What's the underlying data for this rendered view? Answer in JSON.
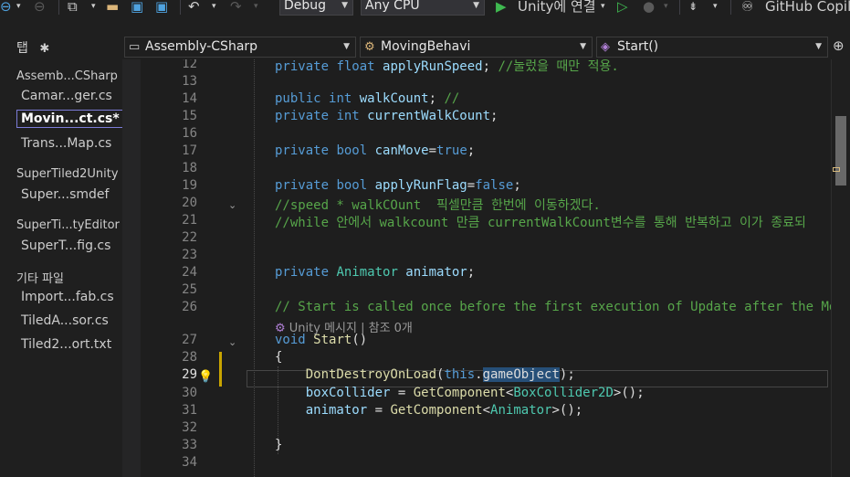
{
  "toolbar": {
    "configuration": "Debug",
    "platform": "Any CPU",
    "run_target": "Unity에 연결",
    "copilot": "GitHub Copilo"
  },
  "navbar": {
    "tab_label": "탭",
    "project_combo": "Assembly-CSharp",
    "class_combo": "MovingBehavi",
    "member_combo": "Start()"
  },
  "sidebar": {
    "items": [
      {
        "kind": "group",
        "label": "Assemb...CSharp"
      },
      {
        "kind": "file",
        "label": "Camar...ger.cs"
      },
      {
        "kind": "file",
        "label": "Movin...ct.cs*",
        "active": true
      },
      {
        "kind": "file",
        "label": "Trans...Map.cs"
      },
      {
        "kind": "group",
        "label": "SuperTiled2Unity"
      },
      {
        "kind": "file",
        "label": "Super...smdef"
      },
      {
        "kind": "group",
        "label": "SuperTi...tyEditor"
      },
      {
        "kind": "file",
        "label": "SuperT...fig.cs"
      },
      {
        "kind": "group",
        "label": "기타 파일"
      },
      {
        "kind": "file",
        "label": "Import...fab.cs"
      },
      {
        "kind": "file",
        "label": "TiledA...sor.cs"
      },
      {
        "kind": "file",
        "label": "Tiled2...ort.txt"
      }
    ]
  },
  "editor": {
    "line_numbers": [
      "12",
      "13",
      "14",
      "15",
      "16",
      "17",
      "18",
      "19",
      "20",
      "21",
      "22",
      "23",
      "24",
      "25",
      "26",
      "27",
      "28",
      "29",
      "30",
      "31",
      "32",
      "33",
      "34"
    ],
    "codelens": "Unity 메시지 | 참조 0개",
    "lines": [
      {
        "n": "12",
        "tokens": [
          [
            "kw",
            "private "
          ],
          [
            "kw",
            "float "
          ],
          [
            "var",
            "applyRunSpeed"
          ],
          [
            "",
            "; "
          ],
          [
            "cm",
            "//눌렀을 때만 적용."
          ]
        ]
      },
      {
        "n": "13",
        "tokens": []
      },
      {
        "n": "14",
        "tokens": [
          [
            "kw",
            "public "
          ],
          [
            "kw",
            "int "
          ],
          [
            "var",
            "walkCount"
          ],
          [
            "",
            "; "
          ],
          [
            "cm",
            "//"
          ]
        ]
      },
      {
        "n": "15",
        "tokens": [
          [
            "kw",
            "private "
          ],
          [
            "kw",
            "int "
          ],
          [
            "var",
            "currentWalkCount"
          ],
          [
            "",
            ";"
          ]
        ]
      },
      {
        "n": "16",
        "tokens": []
      },
      {
        "n": "17",
        "tokens": [
          [
            "kw",
            "private "
          ],
          [
            "kw",
            "bool "
          ],
          [
            "var",
            "canMove"
          ],
          [
            "",
            "="
          ],
          [
            "kw",
            "true"
          ],
          [
            "",
            ";"
          ]
        ]
      },
      {
        "n": "18",
        "tokens": []
      },
      {
        "n": "19",
        "tokens": [
          [
            "kw",
            "private "
          ],
          [
            "kw",
            "bool "
          ],
          [
            "var",
            "applyRunFlag"
          ],
          [
            "",
            "="
          ],
          [
            "kw",
            "false"
          ],
          [
            "",
            ";"
          ]
        ]
      },
      {
        "n": "20",
        "tokens": [
          [
            "cm",
            "//speed * walkCOunt  픽셀만큼 한번에 이동하겠다."
          ]
        ]
      },
      {
        "n": "21",
        "tokens": [
          [
            "cm",
            "//while 안에서 walkcount 만큼 currentWalkCount변수를 통해 반복하고 이가 종료되"
          ]
        ]
      },
      {
        "n": "22",
        "tokens": []
      },
      {
        "n": "23",
        "tokens": []
      },
      {
        "n": "24",
        "tokens": [
          [
            "kw",
            "private "
          ],
          [
            "ty",
            "Animator "
          ],
          [
            "var",
            "animator"
          ],
          [
            "",
            ";"
          ]
        ]
      },
      {
        "n": "25",
        "tokens": []
      },
      {
        "n": "26",
        "tokens": [
          [
            "cm",
            "// Start is called once before the first execution of Update after the MonoBeh"
          ]
        ]
      },
      {
        "n": "27",
        "tokens": [
          [
            "kw",
            "void "
          ],
          [
            "meth",
            "Start"
          ],
          [
            "",
            "()"
          ]
        ]
      },
      {
        "n": "28",
        "tokens": [
          [
            "",
            "{"
          ]
        ]
      },
      {
        "n": "29",
        "tokens": [
          [
            "",
            "    "
          ],
          [
            "meth",
            "DontDestroyOnLoad"
          ],
          [
            "",
            "("
          ],
          [
            "kw",
            "this"
          ],
          [
            "",
            "."
          ],
          [
            "sel",
            "gameObject"
          ],
          [
            "",
            ");"
          ]
        ]
      },
      {
        "n": "30",
        "tokens": [
          [
            "",
            "    "
          ],
          [
            "var",
            "boxCollider"
          ],
          [
            "",
            " = "
          ],
          [
            "meth",
            "GetComponent"
          ],
          [
            "",
            "<"
          ],
          [
            "ty",
            "BoxCollider2D"
          ],
          [
            "",
            ">();"
          ]
        ]
      },
      {
        "n": "31",
        "tokens": [
          [
            "",
            "    "
          ],
          [
            "var",
            "animator"
          ],
          [
            "",
            " = "
          ],
          [
            "meth",
            "GetComponent"
          ],
          [
            "",
            "<"
          ],
          [
            "ty",
            "Animator"
          ],
          [
            "",
            ">();"
          ]
        ]
      },
      {
        "n": "32",
        "tokens": []
      },
      {
        "n": "33",
        "tokens": [
          [
            "",
            "}"
          ]
        ]
      },
      {
        "n": "34",
        "tokens": []
      }
    ]
  },
  "icons": {
    "back": "back-arrow-icon",
    "forward": "forward-arrow-icon",
    "new_item": "new-item-icon",
    "open": "open-folder-icon",
    "save": "save-icon",
    "save_all": "save-all-icon",
    "undo": "undo-icon",
    "redo": "redo-icon",
    "start": "play-icon",
    "start_no_debug": "play-outline-icon",
    "hot_reload": "flame-icon",
    "copilot": "copilot-icon",
    "lightbulb": "lightbulb-icon"
  },
  "colors": {
    "keyword": "#569cd6",
    "type": "#4ec9b0",
    "comment": "#57a64a",
    "method": "#dcdcaa",
    "variable": "#9cdcfe",
    "selection": "#264f78",
    "run_green": "#3fb950"
  }
}
